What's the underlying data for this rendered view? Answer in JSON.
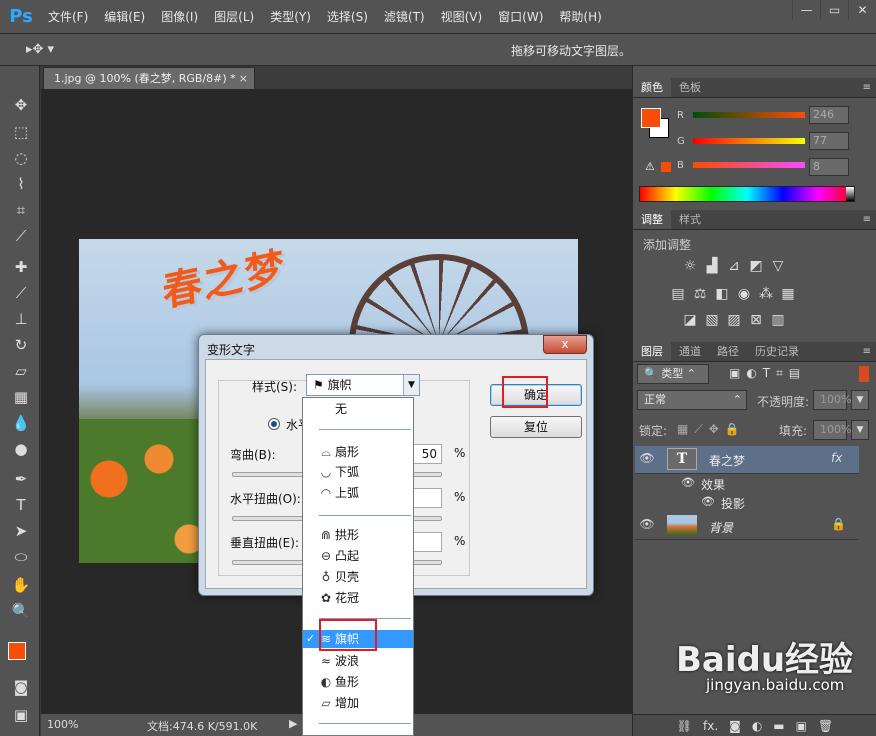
{
  "app": {
    "logo": "Ps"
  },
  "menu": [
    "文件(F)",
    "编辑(E)",
    "图像(I)",
    "图层(L)",
    "类型(Y)",
    "选择(S)",
    "滤镜(T)",
    "视图(V)",
    "窗口(W)",
    "帮助(H)"
  ],
  "window_controls": {
    "minimize": "—",
    "restore": "▭",
    "close": "✕"
  },
  "options": {
    "hint": "拖移可移动文字图层。"
  },
  "document": {
    "tab_title": "1.jpg @ 100% (春之梦, RGB/8#) *",
    "close": "×",
    "art_text": "春之梦",
    "zoom": "100%",
    "doc_size": "文档:474.6 K/591.0K"
  },
  "panels": {
    "color_tabs": [
      "颜色",
      "色板"
    ],
    "color": {
      "r_label": "R",
      "g_label": "G",
      "b_label": "B",
      "r": "246",
      "g": "77",
      "b": "8",
      "fg": "#f64d08"
    },
    "adj_tabs": [
      "调整",
      "样式"
    ],
    "adj_title": "添加调整",
    "layer_tabs": [
      "图层",
      "通道",
      "路径",
      "历史记录"
    ],
    "layers": {
      "filter_kind": "类型",
      "blend_mode": "正常",
      "opacity_label": "不透明度:",
      "opacity": "100%",
      "lock_label": "锁定:",
      "fill_label": "填充:",
      "fill": "100%",
      "text_layer": "春之梦",
      "text_thumb": "T",
      "fx": "fx",
      "effects": "效果",
      "shadow": "投影",
      "background": "背景"
    }
  },
  "dialog": {
    "title": "变形文字",
    "close": "x",
    "style_label": "样式(S):",
    "style_value": "旗帜",
    "orientation_label": "水平",
    "bend_label": "弯曲(B):",
    "bend_value": "50",
    "h_distort_label": "水平扭曲(O):",
    "v_distort_label": "垂直扭曲(E):",
    "pct": "%",
    "ok": "确定",
    "cancel": "复位"
  },
  "dropdown": {
    "items": [
      "无",
      "扇形",
      "下弧",
      "上弧",
      "拱形",
      "凸起",
      "贝壳",
      "花冠",
      "旗帜",
      "波浪",
      "鱼形",
      "增加"
    ],
    "selected": "旗帜",
    "check": "✓"
  },
  "watermark": {
    "main": "Baidu经验",
    "sub": "jingyan.baidu.com"
  }
}
